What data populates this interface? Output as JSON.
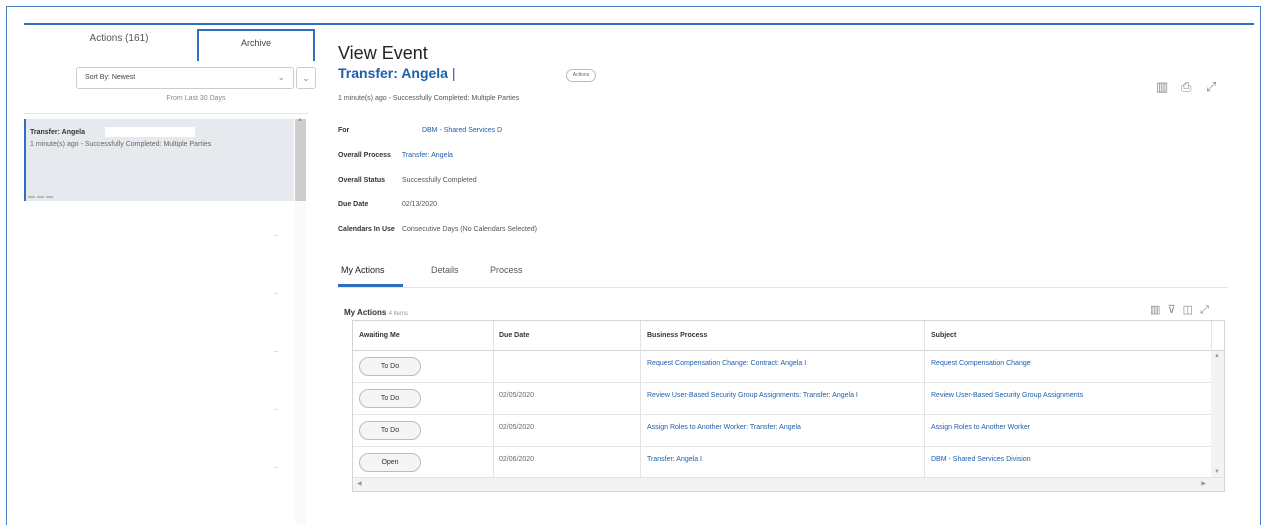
{
  "sidebar": {
    "tab_actions": "Actions (161)",
    "tab_archive": "Archive",
    "sort_label": "Sort By: Newest",
    "from_last": "From Last 30 Days",
    "item": {
      "title": "Transfer: Angela",
      "desc": "1 minute(s) ago - Successfully Completed: Multiple Parties"
    }
  },
  "event": {
    "heading": "View Event",
    "title": "Transfer: Angela",
    "title_bar": "|",
    "actions_chip": "Actions",
    "subline": "1 minute(s) ago - Successfully Completed: Multiple Parties",
    "fields": [
      {
        "label": "For",
        "value": "DBM - Shared Services D"
      },
      {
        "label": "Overall Process",
        "value": "Transfer: Angela"
      },
      {
        "label": "Overall Status",
        "value": "Successfully Completed"
      },
      {
        "label": "Due Date",
        "value": "02/13/2020"
      },
      {
        "label": "Calendars In Use",
        "value": "Consecutive Days (No Calendars Selected)"
      }
    ]
  },
  "tabs": [
    "My Actions",
    "Details",
    "Process"
  ],
  "my_actions": {
    "title": "My Actions",
    "count": "4 items",
    "columns": [
      "Awaiting Me",
      "Due Date",
      "Business Process",
      "Subject"
    ],
    "rows": [
      {
        "action": "To Do",
        "date": "",
        "bp": "Request Compensation Change: Contract: Angela I",
        "subject": "Request Compensation Change"
      },
      {
        "action": "To Do",
        "date": "02/05/2020",
        "bp": "Review User-Based Security Group Assignments: Transfer: Angela I",
        "subject": "Review User-Based Security Group Assignments"
      },
      {
        "action": "To Do",
        "date": "02/05/2020",
        "bp": "Assign Roles to Another Worker: Transfer: Angela",
        "subject": "Assign Roles to Another Worker"
      },
      {
        "action": "Open",
        "date": "02/06/2020",
        "bp": "Transfer: Angela I",
        "subject": "DBM - Shared Services Division"
      }
    ]
  },
  "icons": {
    "top": [
      "export-to-excel-icon",
      "print-icon",
      "expand-icon"
    ],
    "table": [
      "export-to-excel-icon",
      "filter-icon",
      "columns-icon",
      "fullscreen-icon"
    ]
  }
}
